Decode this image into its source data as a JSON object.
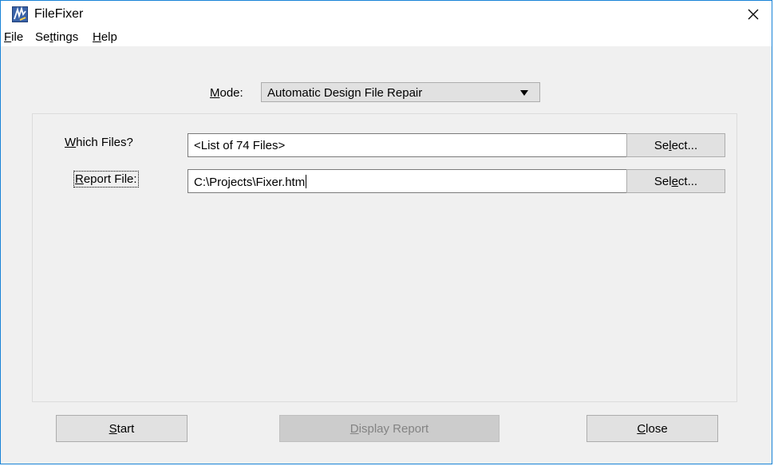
{
  "window": {
    "title": "FileFixer",
    "app_icon": "filefixer-logo-icon",
    "close_icon": "close-icon"
  },
  "menu": [
    {
      "label": "File",
      "accel": "F",
      "rest": "ile"
    },
    {
      "label": "Settings",
      "accel": "t",
      "pre": "Se",
      "rest": "tings"
    },
    {
      "label": "Help",
      "accel": "H",
      "rest": "elp"
    }
  ],
  "mode": {
    "label_accel": "M",
    "label_rest": "ode:",
    "label": "Mode:",
    "selected": "Automatic Design File Repair"
  },
  "which_files": {
    "label_accel": "W",
    "label_rest": "hich Files?",
    "label": "Which Files?",
    "value": "<List of 74 Files>",
    "button_pre": "Se",
    "button_accel": "l",
    "button_rest": "ect...",
    "button": "Select..."
  },
  "report_file": {
    "label_accel": "R",
    "label_rest": "eport File:",
    "label": "Report File:",
    "value": "C:\\Projects\\Fixer.htm",
    "button_pre": "Sel",
    "button_accel": "e",
    "button_rest": "ct...",
    "button": "Select..."
  },
  "buttons": {
    "start_accel": "S",
    "start_rest": "tart",
    "start": "Start",
    "display_accel": "D",
    "display_rest": "isplay Report",
    "display": "Display Report",
    "close_accel": "C",
    "close_rest": "lose",
    "close": "Close"
  },
  "colors": {
    "accent_border": "#1883d7",
    "dialog_bg": "#f0f0f0",
    "button_bg": "#e1e1e1"
  }
}
